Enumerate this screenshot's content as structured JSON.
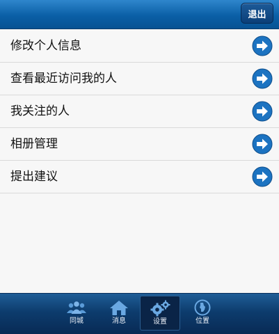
{
  "header": {
    "logout_label": "退出"
  },
  "menu": {
    "items": [
      {
        "label": "修改个人信息",
        "icon": "arrow-right-icon"
      },
      {
        "label": "查看最近访问我的人",
        "icon": "arrow-right-icon"
      },
      {
        "label": "我关注的人",
        "icon": "arrow-right-icon"
      },
      {
        "label": "相册管理",
        "icon": "arrow-right-icon"
      },
      {
        "label": "提出建议",
        "icon": "arrow-right-icon"
      }
    ]
  },
  "tabbar": {
    "tabs": [
      {
        "label": "同城",
        "icon": "people-icon"
      },
      {
        "label": "消息",
        "icon": "home-icon"
      },
      {
        "label": "设置",
        "icon": "gears-icon",
        "active": true
      },
      {
        "label": "位置",
        "icon": "location-icon"
      }
    ]
  },
  "colors": {
    "header": "#0a5fa6",
    "tabbar": "#0d3c6d",
    "arrow_button": "#1c73c1",
    "background": "#f7f7f7"
  }
}
